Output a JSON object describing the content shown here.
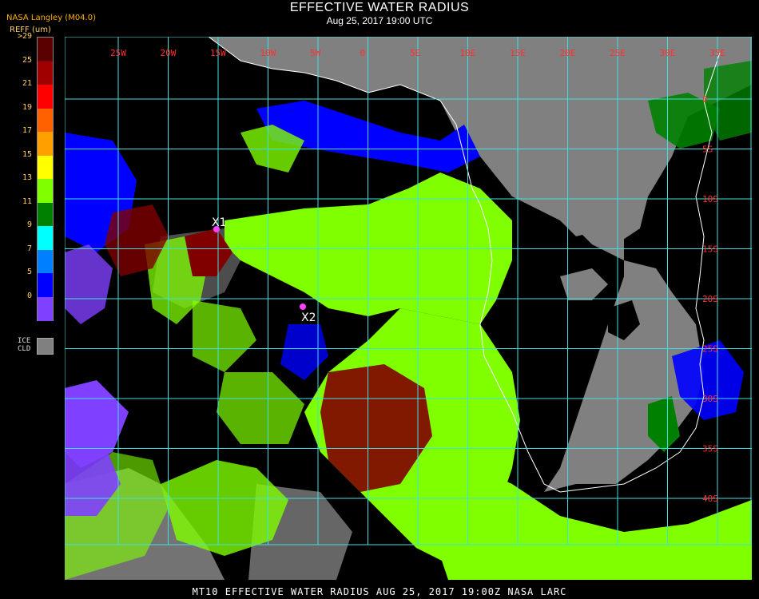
{
  "header": {
    "title": "EFFECTIVE WATER RADIUS",
    "datetime": "Aug 25, 2017 19:00 UTC",
    "provider": "NASA Langley (M04.0)",
    "units": "REFF (um)"
  },
  "legend": {
    "labels": [
      ">29",
      "25",
      "21",
      "19",
      "17",
      "15",
      "13",
      "11",
      "9",
      "7",
      "5",
      "0"
    ],
    "colors": [
      "#5a0000",
      "#a00000",
      "#ff0000",
      "#ff6000",
      "#ffa000",
      "#ffff00",
      "#80ff00",
      "#008000",
      "#00ffff",
      "#0080ff",
      "#0000ff",
      "#8040ff"
    ],
    "ice_label_1": "ICE",
    "ice_label_2": "CLD",
    "ice_color": "#808080"
  },
  "map": {
    "grid_color": "#40e0e0",
    "label_color": "#ff3030",
    "lon_labels": [
      "25W",
      "20W",
      "15W",
      "10W",
      "5W",
      "0",
      "5E",
      "10E",
      "15E",
      "20E",
      "25E",
      "30E",
      "35E"
    ],
    "lat_labels": [
      "0",
      "5S",
      "10S",
      "15S",
      "20S",
      "25S",
      "30S",
      "35S",
      "40S"
    ],
    "markers": [
      {
        "label": "X1",
        "color": "#ff40ff"
      },
      {
        "label": "X2",
        "color": "#ff40ff"
      }
    ],
    "colors": {
      "land": "#808080",
      "ocean": "#000000",
      "cloud_main": "#80ff00",
      "cloud_dark": "#008000",
      "cloud_blue": "#0000ff",
      "cloud_purple": "#8040ff",
      "cloud_red": "#800000",
      "coast": "#ffffff"
    }
  },
  "footer": {
    "text": "MT10  EFFECTIVE WATER RADIUS   AUG 25, 2017 19:00Z   NASA LARC"
  }
}
